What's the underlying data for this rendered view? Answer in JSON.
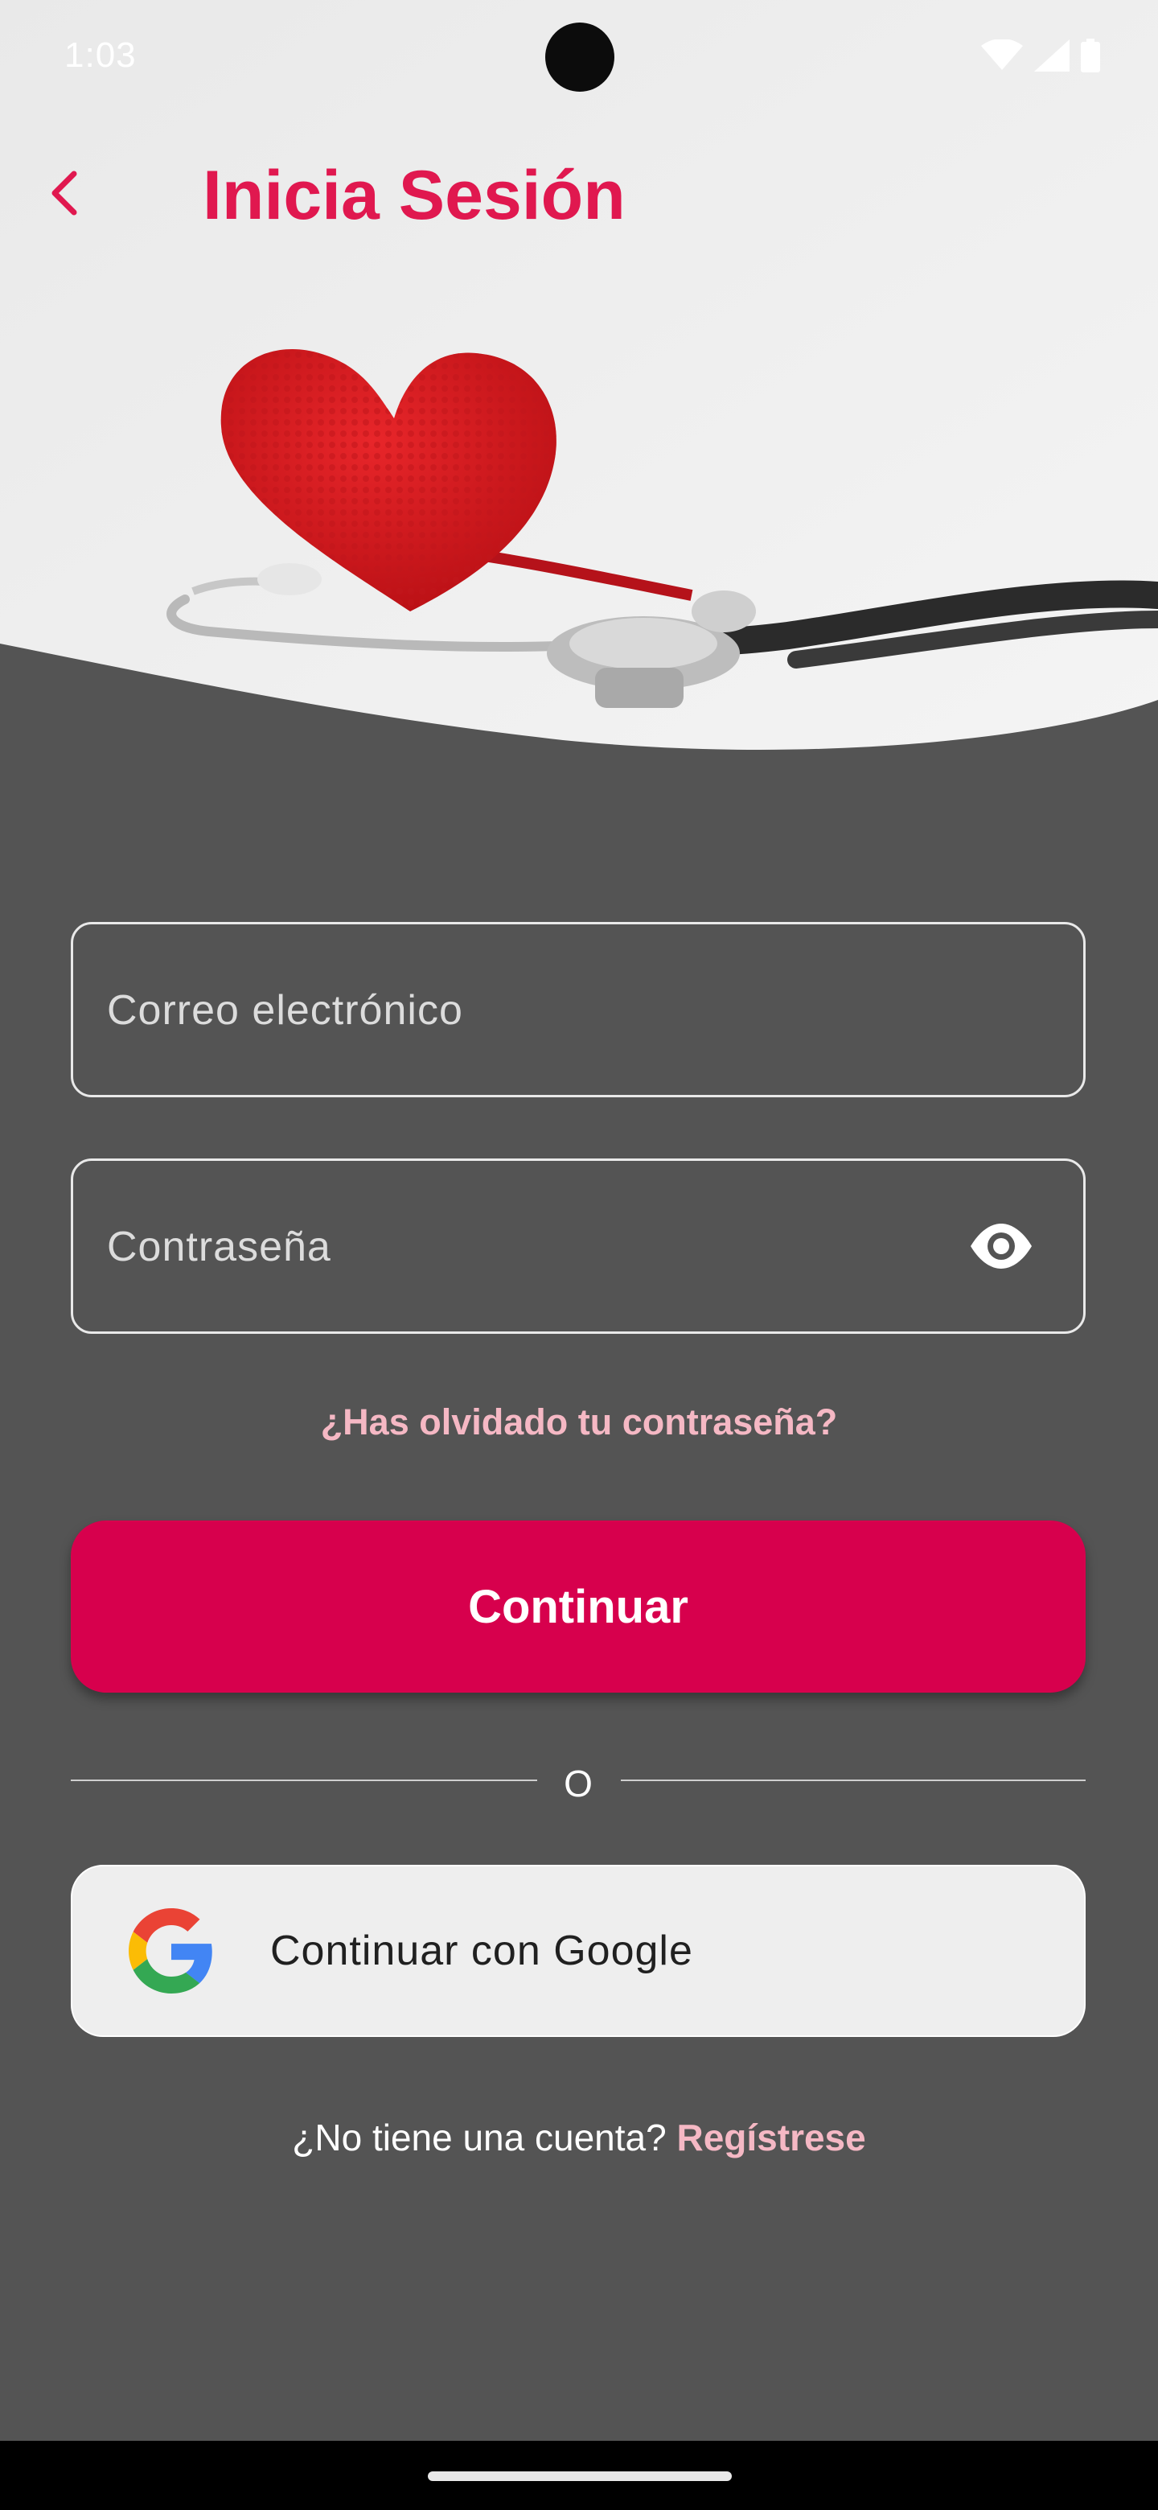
{
  "status_bar": {
    "time": "1:03",
    "icons": [
      "wifi-icon",
      "cell-signal-icon",
      "battery-icon"
    ]
  },
  "header": {
    "back_icon": "chevron-left-icon",
    "title": "Inicia Sesión"
  },
  "hero": {
    "image": "crochet-heart-with-stethoscope"
  },
  "form": {
    "email": {
      "placeholder": "Correo electrónico",
      "value": ""
    },
    "password": {
      "placeholder": "Contraseña",
      "value": "",
      "toggle_icon": "eye-icon"
    },
    "forgot_password": "¿Has olvidado tu contraseña?",
    "continue_label": "Continuar",
    "divider_label": "O",
    "google_label": "Continuar con Google",
    "google_icon": "google-logo-icon"
  },
  "footer": {
    "prompt": "¿No tiene una cuenta? ",
    "register_link": "Regístrese"
  },
  "colors": {
    "accent": "#d7004d",
    "title": "#e0184f",
    "link": "#f5b8c4",
    "background": "#545454"
  }
}
